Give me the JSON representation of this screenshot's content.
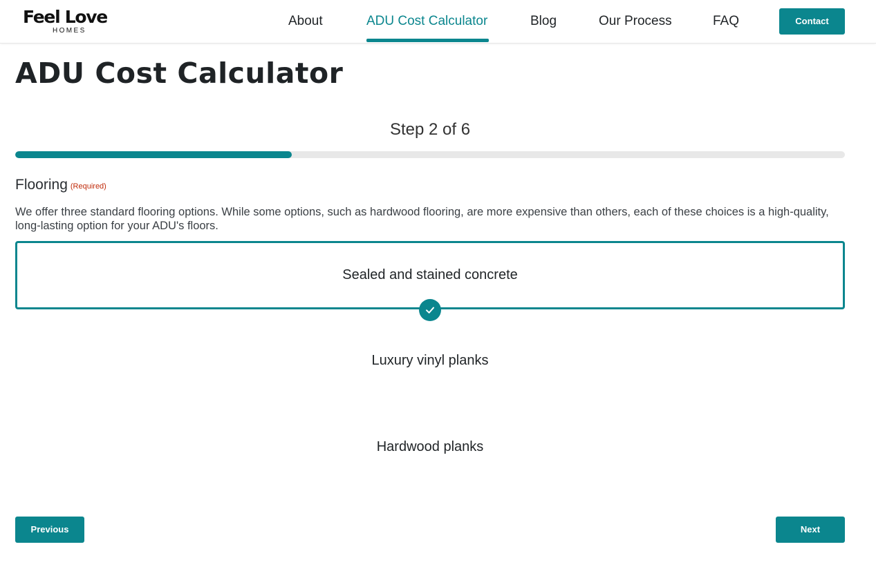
{
  "header": {
    "logo_main": "Feel Love",
    "logo_sub": "HOMES",
    "nav": [
      {
        "label": "About"
      },
      {
        "label": "ADU Cost Calculator"
      },
      {
        "label": "Blog"
      },
      {
        "label": "Our Process"
      },
      {
        "label": "FAQ"
      }
    ],
    "active_nav": "ADU Cost Calculator",
    "contact_label": "Contact"
  },
  "main": {
    "title": "ADU Cost Calculator",
    "step_label": "Step 2 of 6",
    "progress": {
      "current": 2,
      "total": 6
    },
    "field": {
      "label": "Flooring",
      "required_label": "(Required)",
      "description": "We offer three standard flooring options. While some options, such as hardwood flooring, are more expensive than others, each of these choices is a high-quality, long-lasting option for your ADU's floors.",
      "options": [
        {
          "label": "Sealed and stained concrete",
          "selected": true
        },
        {
          "label": "Luxury vinyl planks",
          "selected": false
        },
        {
          "label": "Hardwood planks",
          "selected": false
        }
      ]
    },
    "previous_label": "Previous",
    "next_label": "Next"
  },
  "colors": {
    "accent": "#0b868e",
    "required": "#c02b0a",
    "track": "#e8e8e8",
    "text": "#1f2326"
  },
  "icons": {
    "check": "check-icon"
  }
}
